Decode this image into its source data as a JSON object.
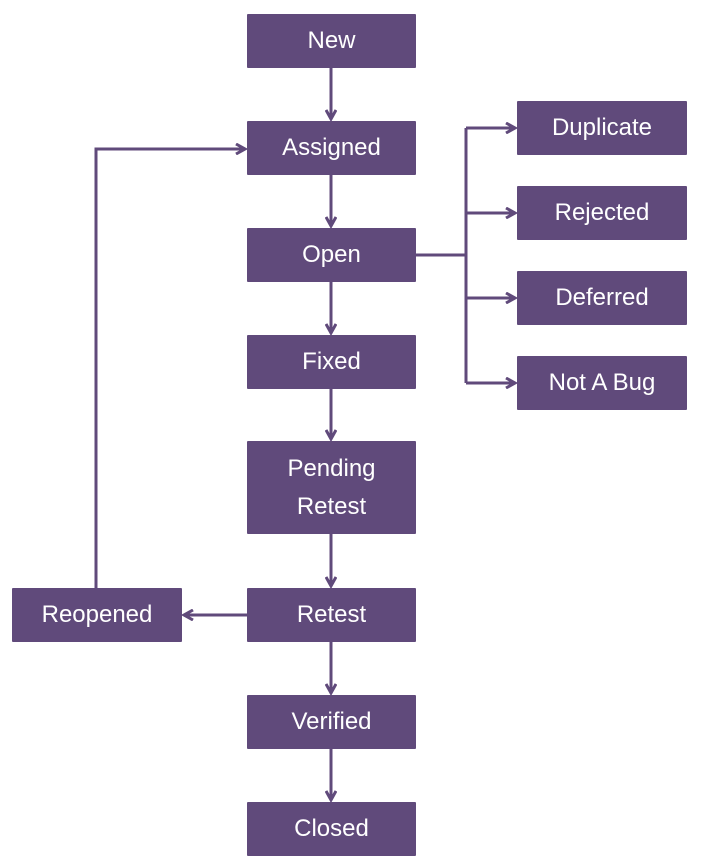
{
  "colors": {
    "box": "#604a7b",
    "line": "#604a7b",
    "text": "#ffffff"
  },
  "states": {
    "new": "New",
    "assigned": "Assigned",
    "open": "Open",
    "fixed": "Fixed",
    "pending_retest_1": "Pending",
    "pending_retest_2": "Retest",
    "retest": "Retest",
    "verified": "Verified",
    "closed": "Closed",
    "reopened": "Reopened",
    "duplicate": "Duplicate",
    "rejected": "Rejected",
    "deferred": "Deferred",
    "not_a_bug": "Not A Bug"
  }
}
